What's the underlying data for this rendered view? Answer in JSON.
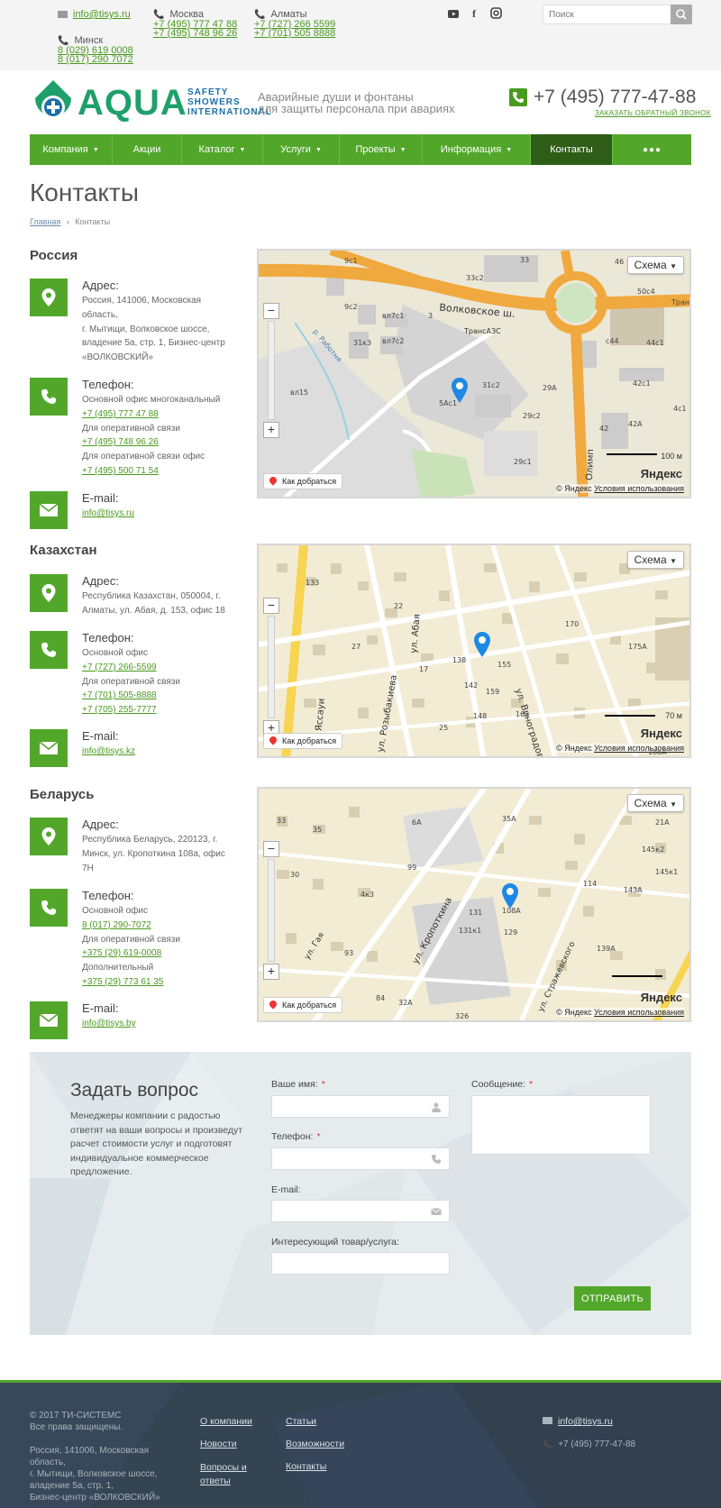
{
  "topbar": {
    "email": "info@tisys.ru",
    "moscow": {
      "label": "Москва",
      "phones": [
        "+7 (495) 777 47 88",
        "+7 (495) 748 96 26"
      ]
    },
    "almaty": {
      "label": "Алматы",
      "phones": [
        "+7 (727) 266 5599",
        "+7 (701) 505 8888"
      ]
    },
    "minsk": {
      "label": "Минск",
      "phones": [
        "8 (029) 619 0008",
        "8 (017) 290 7072"
      ]
    },
    "search_placeholder": "Поиск"
  },
  "header": {
    "logo_main": "AQUA",
    "logo_sub": [
      "SAFETY",
      "SHOWERS",
      "INTERNATIONAL"
    ],
    "tagline": [
      "Аварийные души и фонтаны",
      "для защиты персонала при авариях"
    ],
    "phone": "+7 (495) 777-47-88",
    "callback": "ЗАКАЗАТЬ ОБРАТНЫЙ ЗВОНОК"
  },
  "nav": [
    {
      "label": "Компания",
      "dropdown": true
    },
    {
      "label": "Акции",
      "dropdown": false
    },
    {
      "label": "Каталог",
      "dropdown": true
    },
    {
      "label": "Услуги",
      "dropdown": true
    },
    {
      "label": "Проекты",
      "dropdown": true
    },
    {
      "label": "Информация",
      "dropdown": true
    },
    {
      "label": "Контакты",
      "dropdown": false
    },
    {
      "label": "●●●",
      "dropdown": false
    }
  ],
  "page": {
    "title": "Контакты",
    "breadcrumb_home": "Главная",
    "breadcrumb_current": "Контакты"
  },
  "labels": {
    "address": "Адрес:",
    "phone": "Телефон:",
    "email": "E-mail:"
  },
  "russia": {
    "name": "Россия",
    "address": [
      "Россия, 141006, Московская",
      "область,",
      "г. Мытищи, Волковское шоссе,",
      "владение 5а, стр. 1, Бизнес-центр",
      "«ВОЛКОВСКИЙ»"
    ],
    "phones": [
      {
        "note": "Основной офис многоканальный",
        "number": "+7 (495) 777 47 88"
      },
      {
        "note": "Для оперативной связи",
        "number": "+7 (495) 748 96 26"
      },
      {
        "note": "Для оперативной связи офис",
        "number": "+7 (495) 500 71 54"
      }
    ],
    "email": "info@tisys.ru"
  },
  "kazakhstan": {
    "name": "Казахстан",
    "address": [
      "Республика Казахстан, 050004, г.",
      "Алматы, ул. Абая, д. 153, офис 18"
    ],
    "phones": [
      {
        "note": "Основной офис",
        "number": "+7 (727) 266-5599"
      },
      {
        "note": "Для оперативной связи",
        "number": "+7 (701) 505-8888"
      },
      {
        "note": "",
        "number": "+7 (705) 255-7777"
      }
    ],
    "email": "info@tisys.kz"
  },
  "belarus": {
    "name": "Беларусь",
    "address": [
      "Республика Беларусь, 220123, г.",
      "Минск, ул. Кропоткина 108а, офис",
      "7Н"
    ],
    "phones": [
      {
        "note": "Основной офис",
        "number": "8 (017) 290-7072"
      },
      {
        "note": "Для оперативной связи",
        "number": "+375 (29) 619-0008"
      },
      {
        "note": "Дополнительный",
        "number": "+375 (29) 773 61 35"
      }
    ],
    "email": "info@tisys.by"
  },
  "map": {
    "schema": "Схема",
    "route": "Как добраться",
    "brand": "Яндекс",
    "copyright": "© Яндекс",
    "terms": "Условия использования",
    "scale1": "100 м",
    "scale2": "70 м",
    "map1_labels": {
      "street": "Волковское ш.",
      "street2": "Волковское ш.",
      "azs": "ТрансАЗС",
      "river": "р. Работня",
      "olimp": "Олимп",
      "tran": "Тран",
      "b1": "33",
      "b2": "33с2",
      "b3": "9с1",
      "b4": "9с2",
      "b5": "вл7с1",
      "b6": "вл7с2",
      "b7": "31к3",
      "b8": "3",
      "b9": "5Ас1",
      "b10": "31с2",
      "b11": "29А",
      "b12": "29с2",
      "b13": "29с1",
      "b14": "вл15",
      "b15": "44с1",
      "b16": "42с1",
      "b17": "42",
      "b18": "42А",
      "b19": "50с4",
      "b20": "с44",
      "b21": "46",
      "b22": "4с1"
    },
    "map2_labels": {
      "s1": "ул. Абая",
      "s2": "ул. Розыбакиева",
      "s3": "ул. Виноградова",
      "s4": "ул. Яссауи",
      "b1": "133",
      "b2": "22",
      "b3": "27",
      "b4": "17",
      "b5": "138",
      "b6": "155",
      "b7": "142",
      "b8": "159",
      "b9": "170",
      "b10": "175А",
      "b11": "148",
      "b12": "163",
      "b13": "25",
      "b14": "186А"
    },
    "map3_labels": {
      "s1": "ул. Кропоткина",
      "s2": "ул. Гая",
      "s3": "ул. Стражевского",
      "b1": "33",
      "b2": "35",
      "b3": "6А",
      "b4": "35А",
      "b5": "99",
      "b6": "131",
      "b7": "131к1",
      "b8": "108А",
      "b9": "129",
      "b10": "114",
      "b11": "145к2",
      "b12": "145к1",
      "b13": "143А",
      "b14": "139А",
      "b15": "32А",
      "b16": "326",
      "b17": "93",
      "b18": "30",
      "b19": "4к3",
      "b20": "84",
      "b21": "21А"
    }
  },
  "form": {
    "title": "Задать вопрос",
    "description": "Менеджеры компании с радостью ответят на ваши вопросы и произведут расчет стоимости услуг и подготовят индивидуальное коммерческое предложение.",
    "name_label": "Ваше имя:",
    "phone_label": "Телефон:",
    "email_label": "E-mail:",
    "product_label": "Интересующий товар/услуга:",
    "message_label": "Сообщение:",
    "required": "*",
    "submit": "ОТПРАВИТЬ"
  },
  "footer": {
    "copyright": "© 2017 ТИ-СИСТЕМС",
    "rights": "Все права защищены.",
    "address": [
      "Россия, 141006, Московская",
      "область,",
      "г. Мытищи, Волковское шоссе,",
      "владение 5а, стр. 1,",
      "Бизнес-центр «ВОЛКОВСКИЙ»"
    ],
    "links_col1": [
      "О компании",
      "Новости",
      "Вопросы и",
      "ответы"
    ],
    "links_col2": [
      "Статьи",
      "Возможности",
      "Контакты"
    ],
    "email": "info@tisys.ru",
    "phone": "+7 (495) 777-47-88"
  },
  "colors": {
    "accent": "#52a72a",
    "nav_active": "#2e5d17",
    "footer_bg": "#354452",
    "logo_green": "#1fa06b",
    "logo_blue": "#1c6fa7"
  }
}
